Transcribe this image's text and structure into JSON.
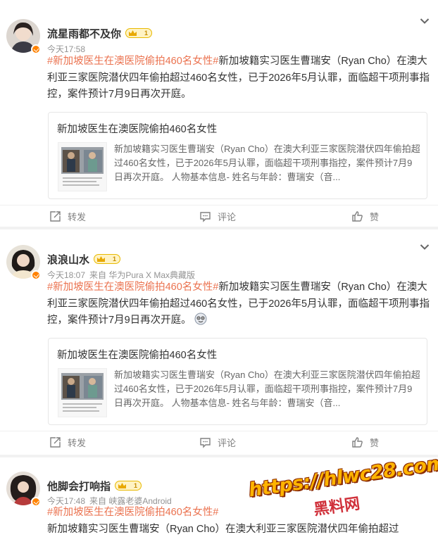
{
  "posts": [
    {
      "user": "流星雨都不及你",
      "level": "1",
      "time": "今天17:58",
      "source": "",
      "tag": "#新加坡医生在澳医院偷拍460名女性#",
      "body": "新加坡籍实习医生曹瑞安（Ryan Cho）在澳大利亚三家医院潜伏四年偷拍超过460名女性，已于2026年5月认罪，面临超干项刑事指控，案件预计7月9日再次开庭。",
      "card_title": "新加坡医生在澳医院偷拍460名女性",
      "card_desc": "新加坡籍实习医生曹瑞安（Ryan Cho）在澳大利亚三家医院潜伏四年偷拍超过460名女性，已于2026年5月认罪，面临超干项刑事指控，案件预计7月9日再次开庭。 人物基本信息- 姓名与年龄：曹瑞安（音..."
    },
    {
      "user": "浪浪山水",
      "level": "1",
      "time": "今天18:07",
      "source": "来自 华为Pura X Max典藏版",
      "tag": "#新加坡医生在澳医院偷拍460名女性#",
      "body": "新加坡籍实习医生曹瑞安（Ryan Cho）在澳大利亚三家医院潜伏四年偷拍超过460名女性，已于2026年5月认罪，面临超干项刑事指控，案件预计7月9日再次开庭。",
      "card_title": "新加坡医生在澳医院偷拍460名女性",
      "card_desc": "新加坡籍实习医生曹瑞安（Ryan Cho）在澳大利亚三家医院潜伏四年偷拍超过460名女性，已于2026年5月认罪，面临超干项刑事指控，案件预计7月9日再次开庭。 人物基本信息- 姓名与年龄：曹瑞安（音..."
    },
    {
      "user": "他脚会打响指",
      "level": "1",
      "time": "今天17:48",
      "source": "来自 峡露老婆Android",
      "tag": "#新加坡医生在澳医院偷拍460名女性#",
      "body": "新加坡籍实习医生曹瑞安（Ryan Cho）在澳大利亚三家医院潜伏四年偷拍超过"
    }
  ],
  "actions": {
    "repost": "转发",
    "comment": "评论",
    "like": "赞"
  },
  "watermark": {
    "url": "https://hlwc28.com",
    "brand": "黑料网"
  },
  "colors": {
    "tag": "#eb7350",
    "vip": "#ff8200",
    "text": "#333333",
    "meta": "#939393"
  },
  "icons": [
    "chevron-down-icon",
    "repost-icon",
    "comment-icon",
    "like-icon",
    "verified-badge-icon",
    "crown-icon",
    "emoji-icon"
  ]
}
